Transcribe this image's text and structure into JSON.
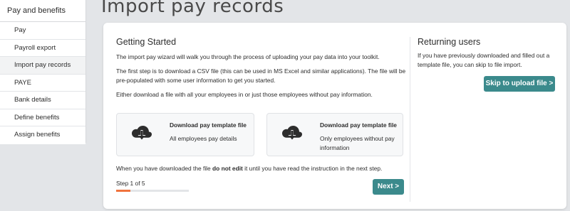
{
  "sidebar": {
    "header": "Pay and benefits",
    "items": [
      {
        "label": "Pay"
      },
      {
        "label": "Payroll export"
      },
      {
        "label": "Import pay records"
      },
      {
        "label": "PAYE"
      },
      {
        "label": "Bank details"
      },
      {
        "label": "Define benefits"
      },
      {
        "label": "Assign benefits"
      }
    ],
    "active_index": 2
  },
  "page": {
    "title": "Import pay records"
  },
  "getting_started": {
    "title": "Getting Started",
    "para1": "The import pay wizard will walk you through the process of uploading your pay data into your toolkit.",
    "para2": "The first step is to download a CSV file (this can be used in MS Excel and similar applications). The file will be pre-populated with some user information to get you started.",
    "para3": "Either download a file with all your employees in or just those employees without pay information.",
    "download_all": {
      "title": "Download pay template file",
      "subtitle": "All employees pay details",
      "icon": "cloud-download-icon"
    },
    "download_missing": {
      "title": "Download pay template file",
      "subtitle": "Only employees without pay information",
      "icon": "cloud-download-icon"
    },
    "note_before": "When you have downloaded the file ",
    "note_bold": "do not edit",
    "note_after": " it until you have read the instruction in the next step.",
    "step_label": "Step 1 of 5",
    "progress": 0.2,
    "next_label": "Next >"
  },
  "returning": {
    "title": "Returning users",
    "text": "If you have previously downloaded and filled out a template file, you can skip to file import.",
    "skip_label": "Skip to upload file >"
  },
  "colors": {
    "accent": "#3b8a8c",
    "progress": "#f0733d",
    "background": "#e3e5e8"
  }
}
